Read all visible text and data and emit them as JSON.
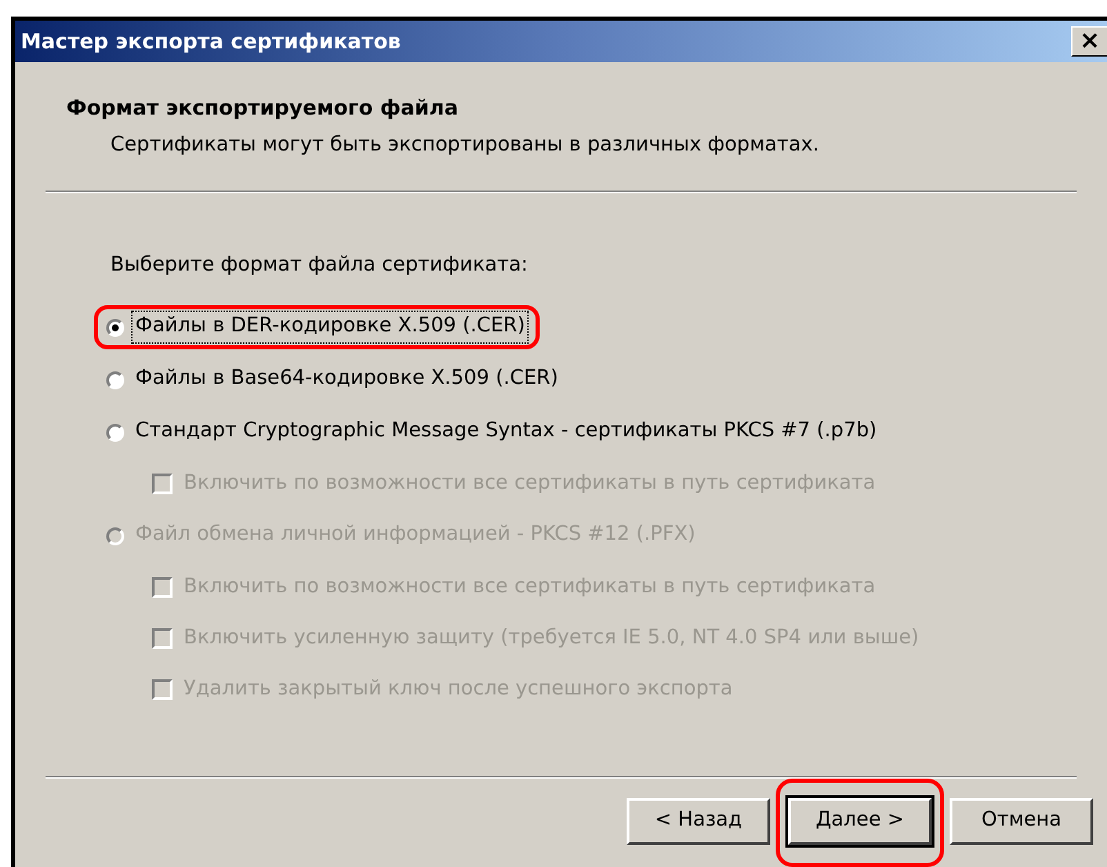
{
  "window": {
    "title": "Мастер экспорта сертификатов",
    "close": "×"
  },
  "header": {
    "title": "Формат экспортируемого файла",
    "subtitle": "Сертификаты могут быть экспортированы в различных форматах."
  },
  "prompt": "Выберите формат файла сертификата:",
  "options": [
    {
      "kind": "radio",
      "label": "Файлы в DER-кодировке X.509 (.CER)",
      "selected": true,
      "disabled": false,
      "focused": true,
      "highlighted": true
    },
    {
      "kind": "radio",
      "label": "Файлы в Base64-кодировке X.509 (.CER)",
      "selected": false,
      "disabled": false,
      "focused": false,
      "highlighted": false
    },
    {
      "kind": "radio",
      "label": "Стандарт Cryptographic Message Syntax - сертификаты PKCS #7 (.p7b)",
      "selected": false,
      "disabled": false,
      "focused": false,
      "highlighted": false,
      "children": [
        {
          "kind": "checkbox",
          "label": "Включить по возможности все сертификаты в путь сертификата",
          "checked": false,
          "disabled": true
        }
      ]
    },
    {
      "kind": "radio",
      "label": "Файл обмена личной информацией - PKCS #12 (.PFX)",
      "selected": false,
      "disabled": true,
      "focused": false,
      "highlighted": false,
      "children": [
        {
          "kind": "checkbox",
          "label": "Включить по возможности все сертификаты в путь сертификата",
          "checked": false,
          "disabled": true
        },
        {
          "kind": "checkbox",
          "label": "Включить усиленную защиту (требуется IE 5.0, NT 4.0 SP4 или выше)",
          "checked": false,
          "disabled": true
        },
        {
          "kind": "checkbox",
          "label": "Удалить закрытый ключ после успешного экспорта",
          "checked": false,
          "disabled": true
        }
      ]
    }
  ],
  "buttons": [
    {
      "label": "< Назад",
      "default": false,
      "highlighted": false
    },
    {
      "label": "Далее >",
      "default": true,
      "highlighted": true
    },
    {
      "label": "Отмена",
      "default": false,
      "highlighted": false
    }
  ]
}
